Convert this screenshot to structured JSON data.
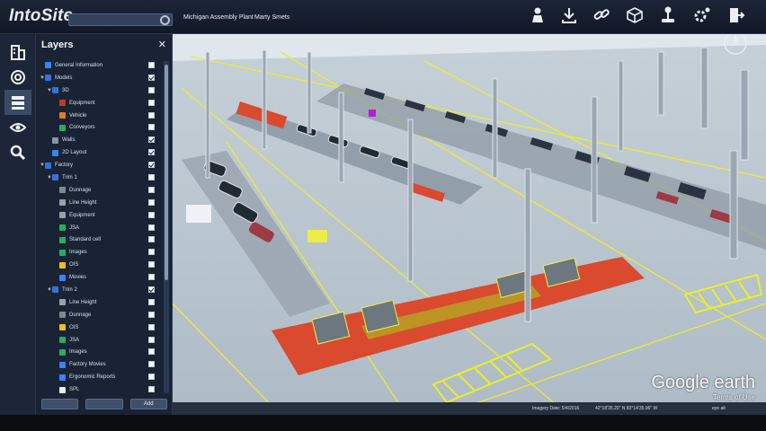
{
  "app": {
    "title": "IntoSite"
  },
  "header": {
    "search_placeholder": "",
    "plant_name": "Michigan Assembly Plant",
    "user_name": "Marty Smets",
    "toolbar_icons": [
      "person-icon",
      "download-icon",
      "link-icon",
      "cube-icon",
      "joystick-icon",
      "settings-gear-icon",
      "exit-icon"
    ]
  },
  "rail": {
    "icons": [
      "building-icon",
      "target-icon",
      "layers-icon",
      "eye-icon",
      "search-icon"
    ]
  },
  "layers_panel": {
    "title": "Layers",
    "close_label": "✕",
    "items": [
      {
        "label": "General Information",
        "checked": false,
        "indent": 0,
        "arrow": "",
        "icon_color": "#3b82f6"
      },
      {
        "label": "Models",
        "checked": true,
        "indent": 0,
        "arrow": "▼",
        "icon_color": "#3b6fdc"
      },
      {
        "label": "3D",
        "checked": false,
        "indent": 1,
        "arrow": "▼",
        "icon_color": "#3b6fdc"
      },
      {
        "label": "Equipment",
        "checked": false,
        "indent": 2,
        "arrow": "",
        "icon_color": "#c0392b"
      },
      {
        "label": "Vehicle",
        "checked": false,
        "indent": 2,
        "arrow": "",
        "icon_color": "#e67e22"
      },
      {
        "label": "Conveyors",
        "checked": false,
        "indent": 2,
        "arrow": "",
        "icon_color": "#27ae60"
      },
      {
        "label": "Walls",
        "checked": true,
        "indent": 1,
        "arrow": "",
        "icon_color": "#8a94a6"
      },
      {
        "label": "2D Layout",
        "checked": true,
        "indent": 1,
        "arrow": "",
        "icon_color": "#3b82f6"
      },
      {
        "label": "Factory",
        "checked": true,
        "indent": 0,
        "arrow": "▼",
        "icon_color": "#3b6fdc"
      },
      {
        "label": "Trim 1",
        "checked": false,
        "indent": 1,
        "arrow": "▼",
        "icon_color": "#3b6fdc"
      },
      {
        "label": "Dunnage",
        "checked": false,
        "indent": 2,
        "arrow": "",
        "icon_color": "#7f8c8d"
      },
      {
        "label": "Line Height",
        "checked": false,
        "indent": 2,
        "arrow": "",
        "icon_color": "#95a5a6"
      },
      {
        "label": "Equipment",
        "checked": false,
        "indent": 2,
        "arrow": "",
        "icon_color": "#95a5a6"
      },
      {
        "label": "JSA",
        "checked": false,
        "indent": 2,
        "arrow": "",
        "icon_color": "#27ae60"
      },
      {
        "label": "Standard cell",
        "checked": false,
        "indent": 2,
        "arrow": "",
        "icon_color": "#27ae60"
      },
      {
        "label": "Images",
        "checked": false,
        "indent": 2,
        "arrow": "",
        "icon_color": "#27ae60"
      },
      {
        "label": "OIS",
        "checked": false,
        "indent": 2,
        "arrow": "",
        "icon_color": "#f1c40f"
      },
      {
        "label": "Movies",
        "checked": false,
        "indent": 2,
        "arrow": "",
        "icon_color": "#3b82f6"
      },
      {
        "label": "Trim 2",
        "checked": true,
        "indent": 1,
        "arrow": "▼",
        "icon_color": "#3b6fdc"
      },
      {
        "label": "Line Height",
        "checked": false,
        "indent": 2,
        "arrow": "",
        "icon_color": "#95a5a6"
      },
      {
        "label": "Dunnage",
        "checked": false,
        "indent": 2,
        "arrow": "",
        "icon_color": "#7f8c8d"
      },
      {
        "label": "OIS",
        "checked": false,
        "indent": 2,
        "arrow": "",
        "icon_color": "#f1c40f"
      },
      {
        "label": "JSA",
        "checked": false,
        "indent": 2,
        "arrow": "",
        "icon_color": "#27ae60"
      },
      {
        "label": "Images",
        "checked": false,
        "indent": 2,
        "arrow": "",
        "icon_color": "#27ae60"
      },
      {
        "label": "Factory Movies",
        "checked": false,
        "indent": 2,
        "arrow": "",
        "icon_color": "#3b82f6"
      },
      {
        "label": "Ergonomic Reports",
        "checked": false,
        "indent": 2,
        "arrow": "",
        "icon_color": "#3b82f6"
      },
      {
        "label": "SPL",
        "checked": false,
        "indent": 2,
        "arrow": "",
        "icon_color": "#ecf0f1"
      }
    ],
    "buttons": [
      "",
      "",
      "Add"
    ]
  },
  "map": {
    "brand": "Google earth",
    "brand_sub": "Terms of Use",
    "status": {
      "imagery_date": "Imagery Date: 5/4/2016",
      "coords": "42°18'35.20\" N  83°14'35.96\" W",
      "eye_alt": "eye alt"
    }
  },
  "colors": {
    "accent": "#3b82f6",
    "floor": "#b9c4cd",
    "yellow_line": "#e8f02a",
    "red_zone": "#d94a2f"
  }
}
